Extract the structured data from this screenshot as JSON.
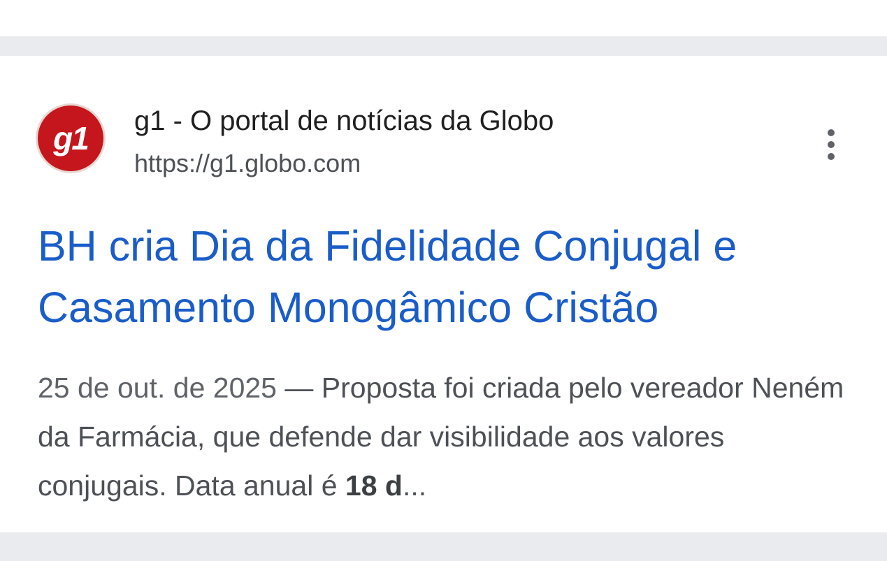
{
  "result": {
    "favicon_text": "g1",
    "favicon_color": "#c4161c",
    "site_name": "g1 - O portal de notícias da Globo",
    "site_url": "https://g1.globo.com",
    "menu_icon": "more-vert-icon",
    "title_line1": "BH cria Dia da Fidelidade Conjugal e",
    "title_line2": "Casamento Monogâmico Cristão",
    "title_color": "#1a5dc9",
    "snippet_date": "25 de out. de 2025",
    "snippet_separator": " — ",
    "snippet_text": "Proposta foi criada pelo vereador Neném da Farmácia, que defende dar visibilidade aos valores conjugais. Data anual é ",
    "snippet_bold": "18 d",
    "snippet_ellipsis": "..."
  }
}
